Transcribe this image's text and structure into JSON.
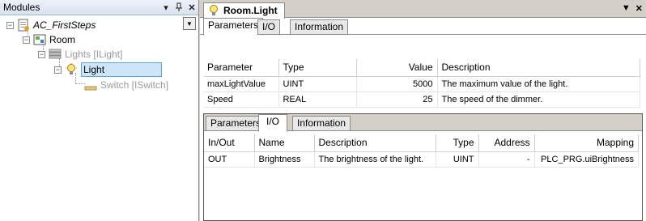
{
  "modules": {
    "title": "Modules",
    "pin_icon": "pin-icon",
    "close_icon": "close-icon",
    "tree": [
      {
        "label": "AC_FirstSteps",
        "icon": "project-icon",
        "expander": "−"
      },
      {
        "label": "Room",
        "icon": "room-icon",
        "expander": "−"
      },
      {
        "label": "Lights [ILight]",
        "icon": "slot-icon",
        "expander": "−"
      },
      {
        "label": "Light",
        "icon": "bulb-icon",
        "expander": "−"
      },
      {
        "label": "Switch [ISwitch]",
        "icon": "switch-slot-icon"
      }
    ]
  },
  "editor": {
    "doc_tab": "Room.Light",
    "top_tabs": [
      "Parameters",
      "I/O",
      "Information"
    ],
    "parameters_table": {
      "headers": [
        "Parameter",
        "Type",
        "Value",
        "Description"
      ],
      "rows": [
        [
          "maxLightValue",
          "UINT",
          "5000",
          "The maximum value of the light."
        ],
        [
          "Speed",
          "REAL",
          "25",
          "The speed of the dimmer."
        ]
      ]
    },
    "bottom_tabs": [
      "Parameters",
      "I/O",
      "Information"
    ],
    "io_table": {
      "headers": [
        "In/Out",
        "Name",
        "Description",
        "Type",
        "Address",
        "Mapping"
      ],
      "rows": [
        [
          "OUT",
          "Brightness",
          "The brightness of the light.",
          "UINT",
          "-",
          "PLC_PRG.uiBrightness"
        ]
      ]
    }
  }
}
